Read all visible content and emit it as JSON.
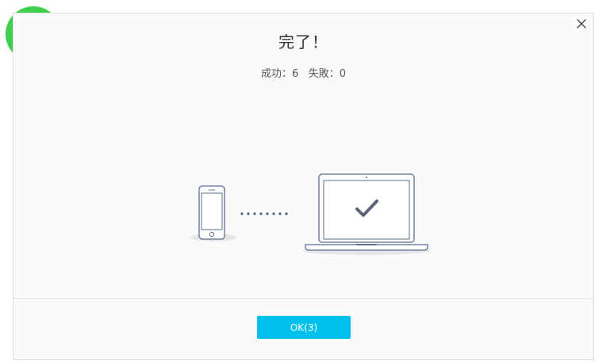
{
  "dialog": {
    "title": "完了！",
    "stats": {
      "success_label": "成功：",
      "success_count": "6",
      "failure_label": "失敗：",
      "failure_count": "0"
    },
    "ok_button_label": "OK(3)",
    "close_icon": "close-icon",
    "badge_icon": "check-circle-icon"
  },
  "colors": {
    "badge_green": "#3ecf4c",
    "accent_button": "#00c0ef",
    "device_stroke": "#5b6e96",
    "check_mark": "#5d6678"
  }
}
